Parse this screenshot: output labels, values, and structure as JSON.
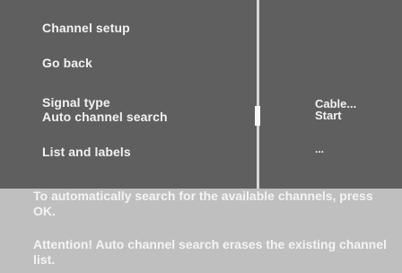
{
  "menu": {
    "items": [
      {
        "label": "Channel setup"
      },
      {
        "label": "Go back"
      },
      {
        "label": "Signal type"
      },
      {
        "label": "Auto channel search"
      },
      {
        "label": "List and labels"
      }
    ],
    "values": {
      "signal_type": "Cable...",
      "auto_channel_search": "Start",
      "list_and_labels": "..."
    }
  },
  "info": {
    "line1": "To automatically search for the available channels, press OK.",
    "line2": "Attention! Auto channel search erases the existing channel list."
  }
}
